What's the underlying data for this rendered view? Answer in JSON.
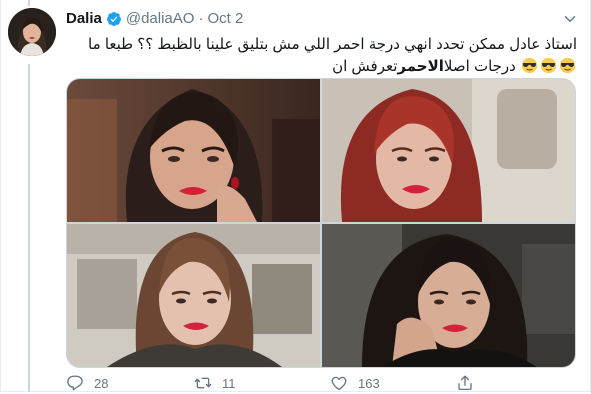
{
  "tweet": {
    "author_name": "Dalia",
    "handle": "@daliaAO",
    "separator": "·",
    "date": "Oct 2",
    "text_line1": "استاذ عادل ممكن تحدد انهي درجة احمر اللي مش بتليق علينا بالظبط ؟؟ طبعا ما",
    "text_line2_pre": "تعرفش ان ",
    "text_line2_bold": "الاحمر",
    "text_line2_post": " درجات اصلا"
  },
  "actions": {
    "replies": "28",
    "retweets": "11",
    "likes": "163"
  },
  "colors": {
    "verified": "#1da1f2",
    "muted": "#657786",
    "lipstick": "#d3213a"
  },
  "icons": [
    "verified-badge-icon",
    "chevron-down-icon",
    "sunglasses-emoji-icon",
    "reply-icon",
    "retweet-icon",
    "like-icon",
    "share-icon"
  ]
}
